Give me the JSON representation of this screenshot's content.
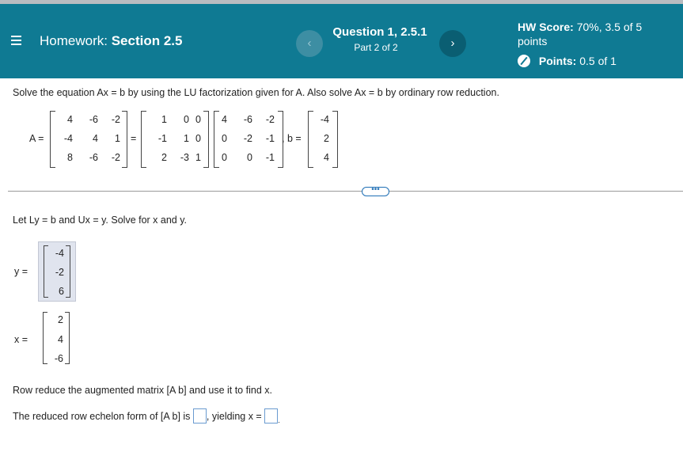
{
  "header": {
    "title_prefix": "Homework:",
    "title_section": "Section 2.5",
    "question_title": "Question 1, 2.5.1",
    "question_part": "Part 2 of 2",
    "hw_score_label": "HW Score:",
    "hw_score_value": "70%, 3.5 of 5",
    "hw_score_unit": "points",
    "points_label": "Points:",
    "points_value": "0.5 of 1",
    "prev_glyph": "‹",
    "next_glyph": "›"
  },
  "problem": {
    "prompt": "Solve the equation Ax = b by using the LU factorization given for A. Also solve Ax = b by ordinary row reduction.",
    "A_label": "A =",
    "eq_sign": "=",
    "b_label": ", b =",
    "matrix_A": [
      [
        "4",
        "-6",
        "-2"
      ],
      [
        "-4",
        "4",
        "1"
      ],
      [
        "8",
        "-6",
        "-2"
      ]
    ],
    "matrix_L": [
      [
        "1",
        "0",
        "0"
      ],
      [
        "-1",
        "1",
        "0"
      ],
      [
        "2",
        "-3",
        "1"
      ]
    ],
    "matrix_U": [
      [
        "4",
        "-6",
        "-2"
      ],
      [
        "0",
        "-2",
        "-1"
      ],
      [
        "0",
        "0",
        "-1"
      ]
    ],
    "vector_b": [
      "-4",
      "2",
      "4"
    ]
  },
  "more_button": "•••",
  "part1": {
    "instruction": "Let Ly = b and Ux = y. Solve for x and y.",
    "y_label": "y =",
    "y_values": [
      "-4",
      "-2",
      "6"
    ],
    "x_label": "x =",
    "x_values": [
      "2",
      "4",
      "-6"
    ]
  },
  "part2": {
    "instruction": "Row reduce the augmented matrix [A b] and use it to find x.",
    "rref_prefix": "The reduced row echelon form of [A b] is",
    "yielding": ", yielding x ="
  }
}
